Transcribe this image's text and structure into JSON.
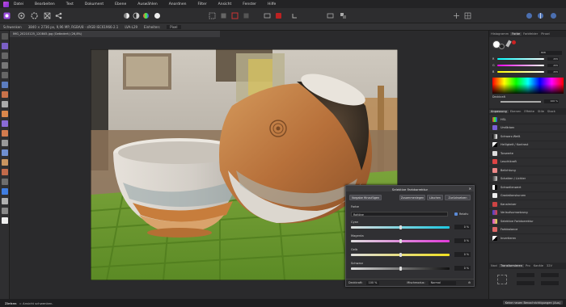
{
  "menu": {
    "items": [
      "Datei",
      "Bearbeiten",
      "Text",
      "Dokument",
      "Ebene",
      "Auswählen",
      "Anordnen",
      "Filter",
      "Ansicht",
      "Fenster",
      "Hilfe"
    ]
  },
  "context_bar": {
    "tool": "Schwenken",
    "info": "3840 × 2736 px, 9,96 MP, RGBA/8 · sRGB IEC61966-2.1",
    "profile": "LVA-L29",
    "units_label": "Einheiten:",
    "units_value": "Pixel"
  },
  "document": {
    "tab_title": "IMG_20210125_120845.jpg (Geändert) (26,8%)"
  },
  "right_panel": {
    "top_tabs": [
      "Histogramm",
      "Farbe",
      "Farbfelder",
      "Pinsel"
    ],
    "active_top_tab": "Farbe",
    "hex": "808",
    "rgb": [
      {
        "label": "R",
        "value": "255"
      },
      {
        "label": "G",
        "value": "255"
      },
      {
        "label": "B",
        "value": "255"
      }
    ],
    "opacity_label": "Deckkraft",
    "opacity_value": "100 %",
    "mid_tabs": [
      "Anpassung",
      "Ebenen",
      "Effekte",
      "Stile",
      "Stock"
    ],
    "active_mid_tab": "Anpassung",
    "adjustments": [
      "HSL",
      "Umfärben",
      "Schwarz-Weiß",
      "Helligkeit / Kontrast",
      "Tonwerte",
      "Leuchtkraft",
      "Belichtung",
      "Schatten / Lichter",
      "Schwellenwert",
      "Gradationskurven",
      "Kanalmixer",
      "Verlaufsumsetzung",
      "Selektive Farbkorrektur",
      "Farbbalance",
      "Invertieren"
    ],
    "bottom_tabs": [
      "Navi",
      "Transformieren",
      "Pro",
      "Kanäle",
      "32V"
    ],
    "active_bottom_tab": "Transformieren"
  },
  "dialog": {
    "title": "Selektive Farbkorrektur",
    "buttons": [
      "Vorgabe Hinzufügen",
      "Zusammenlegen",
      "Löschen",
      "Zurücksetzen"
    ],
    "farbe_label": "Farbe",
    "farbe_value": "Rottöne",
    "relativ_label": "Relativ",
    "sliders": [
      {
        "label": "Cyan",
        "value": "0 %"
      },
      {
        "label": "Magenta",
        "value": "0 %"
      },
      {
        "label": "Gelb",
        "value": "0 %"
      },
      {
        "label": "Schwarz",
        "value": "0 %"
      }
    ],
    "footer": {
      "opacity_label": "Deckkraft:",
      "opacity_value": "100 %",
      "blend_label": "Mischmodus:",
      "blend_value": "Normal"
    }
  },
  "status": {
    "tool_name": "Ziehen",
    "hint": "= Ansicht schwenken.",
    "tooltip": "Keine neuen Benachrichtigungen (Aus)"
  },
  "colors": {
    "accent": "#8a3fe0",
    "dialog_bg": "#303033",
    "app_bg": "#2b2b2d"
  }
}
